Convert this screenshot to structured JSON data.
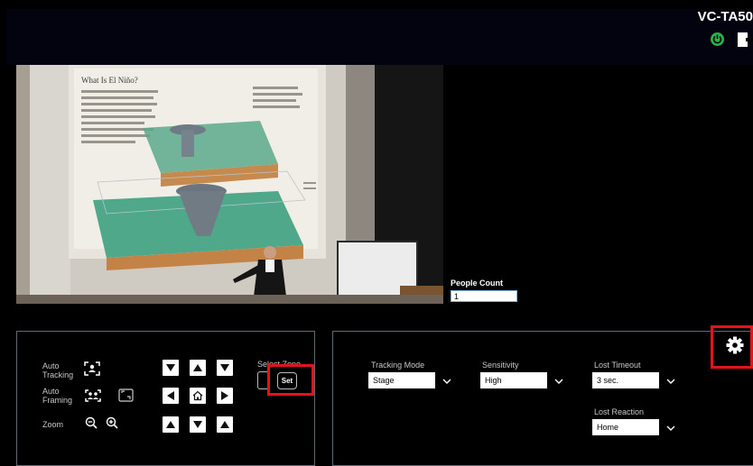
{
  "header": {
    "model": "VC-TA50"
  },
  "video": {
    "slide_title": "What Is El Niño?"
  },
  "people_count": {
    "label": "People Count",
    "value": "1"
  },
  "left_panel": {
    "auto_tracking_label": "Auto\nTracking",
    "auto_framing_label": "Auto\nFraming",
    "zoom_label": "Zoom",
    "select_zone_label": "Select Zone",
    "set_label": "Set"
  },
  "right_panel": {
    "tracking_mode": {
      "label": "Tracking Mode",
      "value": "Stage"
    },
    "sensitivity": {
      "label": "Sensitivity",
      "value": "High"
    },
    "lost_timeout": {
      "label": "Lost Timeout",
      "value": "3 sec."
    },
    "lost_reaction": {
      "label": "Lost Reaction",
      "value": "Home"
    }
  },
  "colors": {
    "accent_green": "#25b34a",
    "highlight_red": "#e3121b",
    "panel_border": "#5f6a72"
  }
}
